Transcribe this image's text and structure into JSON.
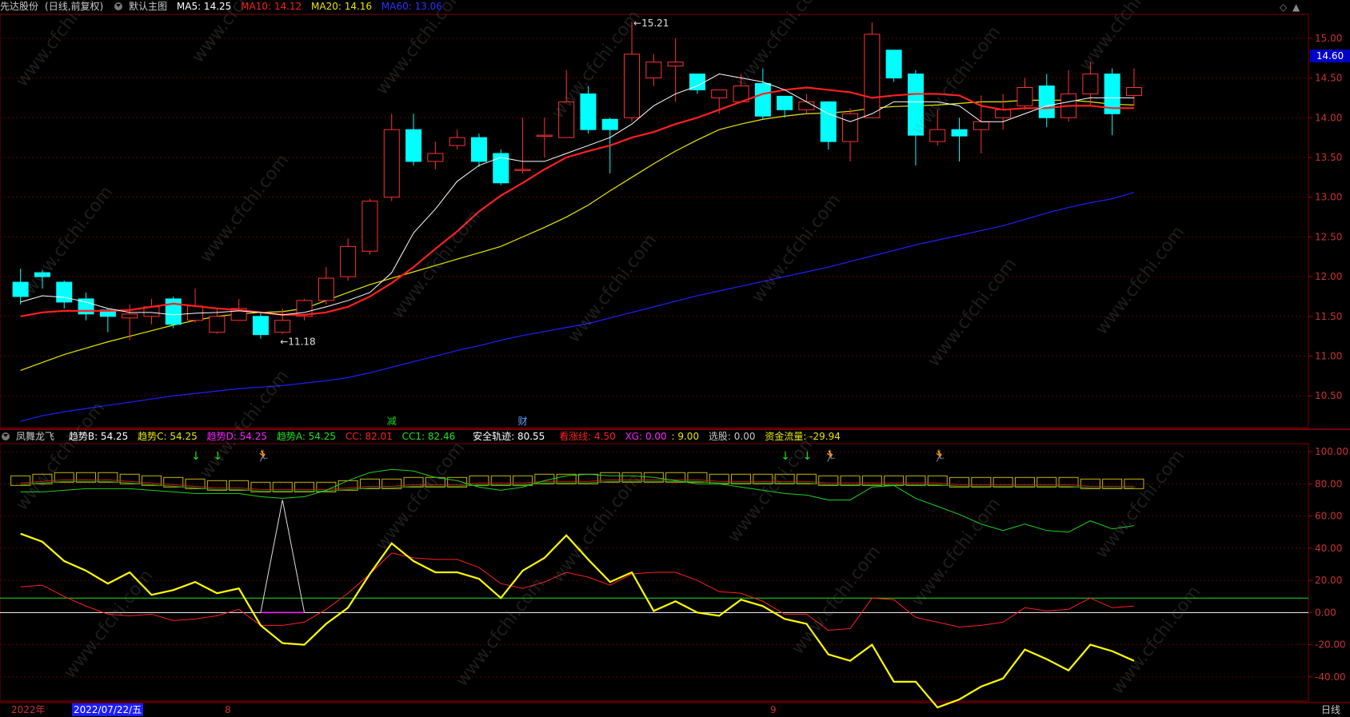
{
  "header_main": {
    "stock": "先达股份",
    "stock_mode": "(日线,前复权)",
    "template": "默认主图",
    "ma5": "MA5: 14.25",
    "ma10": "MA10: 14.12",
    "ma20": "MA20: 14.16",
    "ma60": "MA60: 13.06"
  },
  "header_sub": {
    "indicator": "凤舞龙飞",
    "trend_b": "趋势B: 54.25",
    "trend_c": "趋势C: 54.25",
    "trend_d": "趋势D: 54.25",
    "trend_a": "趋势A: 54.25",
    "cc": "CC: 82.01",
    "cc1": "CC1: 82.46",
    "safe": "安全轨迹: 80.55",
    "sz": "看涨线: 4.50",
    "xg": "XG: 0.00",
    "xg2": ": 9.00",
    "pick": "选股: 0.00",
    "flow": "资金流量: -29.94"
  },
  "colors": {
    "up": "#ff3232",
    "down": "#00ffff",
    "ma5": "#ffffff",
    "ma10": "#ff2020",
    "ma20": "#e8e800",
    "ma60": "#2020ff",
    "grid": "#5a0000",
    "axis_text": "#c83232"
  },
  "price_box": "14.60",
  "price_axis": [
    "15.00",
    "14.50",
    "14.00",
    "13.50",
    "13.00",
    "12.50",
    "12.00",
    "11.50",
    "11.00",
    "10.50"
  ],
  "sub_axis": [
    "100.00",
    "80.00",
    "60.00",
    "40.00",
    "20.00",
    "0.00",
    "-20.00",
    "-40.00"
  ],
  "annotations": {
    "high": "15.21",
    "low": "11.18",
    "mark1": "减",
    "mark2": "财"
  },
  "datebar": {
    "year": "2022年",
    "date": "2022/07/22/五",
    "m8": "8",
    "m9": "9",
    "period": "日线"
  },
  "watermark": "www.cfchi.com",
  "chart_data": {
    "type": "candlestick",
    "ylim": [
      10.1,
      15.3
    ],
    "candles": [
      [
        11.93,
        11.75,
        12.1,
        11.65
      ],
      [
        12.05,
        12.0,
        12.08,
        11.85
      ],
      [
        11.93,
        11.68,
        11.95,
        11.6
      ],
      [
        11.72,
        11.53,
        11.8,
        11.45
      ],
      [
        11.58,
        11.5,
        11.6,
        11.3
      ],
      [
        11.48,
        11.53,
        11.65,
        11.2
      ],
      [
        11.5,
        11.62,
        11.72,
        11.4
      ],
      [
        11.72,
        11.4,
        11.75,
        11.35
      ],
      [
        11.45,
        11.63,
        11.85,
        11.42
      ],
      [
        11.3,
        11.5,
        11.6,
        11.28
      ],
      [
        11.45,
        11.6,
        11.72,
        11.45
      ],
      [
        11.5,
        11.27,
        11.55,
        11.22
      ],
      [
        11.3,
        11.45,
        11.6,
        11.28
      ],
      [
        11.5,
        11.7,
        11.72,
        11.45
      ],
      [
        11.7,
        11.98,
        12.12,
        11.65
      ],
      [
        12.0,
        12.38,
        12.48,
        11.95
      ],
      [
        12.32,
        12.95,
        12.98,
        12.28
      ],
      [
        13.0,
        13.85,
        14.05,
        12.95
      ],
      [
        13.85,
        13.45,
        14.05,
        13.4
      ],
      [
        13.45,
        13.55,
        13.7,
        13.35
      ],
      [
        13.65,
        13.75,
        13.85,
        13.6
      ],
      [
        13.75,
        13.45,
        13.8,
        13.38
      ],
      [
        13.55,
        13.18,
        13.6,
        13.15
      ],
      [
        13.35,
        13.35,
        14.0,
        13.3
      ],
      [
        13.78,
        13.78,
        14.0,
        13.5
      ],
      [
        13.75,
        14.2,
        14.6,
        13.75
      ],
      [
        14.3,
        13.85,
        14.4,
        13.8
      ],
      [
        13.98,
        13.85,
        14.0,
        13.3
      ],
      [
        14.0,
        14.8,
        15.21,
        13.95
      ],
      [
        14.5,
        14.7,
        14.8,
        14.4
      ],
      [
        14.65,
        14.7,
        15.0,
        14.2
      ],
      [
        14.55,
        14.35,
        14.55,
        14.3
      ],
      [
        14.25,
        14.35,
        14.35,
        14.05
      ],
      [
        14.2,
        14.4,
        14.55,
        14.2
      ],
      [
        14.43,
        14.02,
        14.62,
        13.98
      ],
      [
        14.27,
        14.1,
        14.27,
        14.0
      ],
      [
        14.1,
        14.2,
        14.3,
        14.05
      ],
      [
        14.2,
        13.7,
        14.2,
        13.6
      ],
      [
        13.7,
        14.05,
        14.12,
        13.45
      ],
      [
        14.0,
        15.05,
        15.2,
        14.0
      ],
      [
        14.85,
        14.5,
        14.85,
        14.45
      ],
      [
        14.55,
        13.78,
        14.6,
        13.4
      ],
      [
        13.7,
        13.85,
        14.1,
        13.65
      ],
      [
        13.85,
        13.77,
        14.0,
        13.45
      ],
      [
        13.85,
        13.95,
        14.28,
        13.55
      ],
      [
        14.0,
        14.1,
        14.3,
        13.85
      ],
      [
        14.15,
        14.38,
        14.5,
        14.1
      ],
      [
        14.4,
        14.0,
        14.55,
        13.88
      ],
      [
        14.0,
        14.3,
        14.6,
        13.95
      ],
      [
        14.3,
        14.55,
        14.7,
        14.15
      ],
      [
        14.55,
        14.05,
        14.62,
        13.78
      ],
      [
        14.28,
        14.38,
        14.62,
        14.15
      ]
    ],
    "ma5": [
      11.68,
      11.76,
      11.74,
      11.68,
      11.6,
      11.55,
      11.55,
      11.52,
      11.54,
      11.55,
      11.57,
      11.55,
      11.52,
      11.55,
      11.62,
      11.7,
      11.8,
      12.05,
      12.55,
      12.85,
      13.2,
      13.4,
      13.5,
      13.45,
      13.45,
      13.55,
      13.65,
      13.75,
      13.92,
      14.15,
      14.3,
      14.4,
      14.55,
      14.5,
      14.45,
      14.35,
      14.2,
      14.05,
      13.95,
      14.05,
      14.2,
      14.2,
      14.2,
      14.15,
      13.95,
      13.95,
      14.05,
      14.15,
      14.2,
      14.25,
      14.25,
      14.25
    ],
    "ma10": [
      11.5,
      11.55,
      11.57,
      11.57,
      11.57,
      11.58,
      11.62,
      11.66,
      11.63,
      11.6,
      11.58,
      11.55,
      11.52,
      11.52,
      11.55,
      11.62,
      11.75,
      11.92,
      12.12,
      12.35,
      12.57,
      12.82,
      13.02,
      13.18,
      13.35,
      13.5,
      13.58,
      13.65,
      13.75,
      13.82,
      13.92,
      14.0,
      14.1,
      14.2,
      14.3,
      14.35,
      14.38,
      14.35,
      14.32,
      14.25,
      14.28,
      14.3,
      14.3,
      14.28,
      14.15,
      14.1,
      14.12,
      14.12,
      14.15,
      14.15,
      14.12,
      14.12
    ],
    "ma20": [
      10.82,
      10.92,
      11.02,
      11.1,
      11.18,
      11.25,
      11.32,
      11.39,
      11.45,
      11.5,
      11.53,
      11.55,
      11.56,
      11.6,
      11.7,
      11.8,
      11.9,
      11.98,
      12.06,
      12.14,
      12.22,
      12.3,
      12.38,
      12.5,
      12.62,
      12.75,
      12.9,
      13.08,
      13.25,
      13.42,
      13.58,
      13.72,
      13.85,
      13.92,
      13.98,
      14.02,
      14.05,
      14.06,
      14.08,
      14.12,
      14.14,
      14.15,
      14.16,
      14.18,
      14.2,
      14.2,
      14.22,
      14.22,
      14.22,
      14.2,
      14.17,
      14.16
    ],
    "ma60": [
      10.18,
      10.25,
      10.3,
      10.34,
      10.38,
      10.42,
      10.46,
      10.5,
      10.53,
      10.56,
      10.59,
      10.61,
      10.63,
      10.66,
      10.69,
      10.73,
      10.79,
      10.86,
      10.93,
      11.0,
      11.07,
      11.13,
      11.2,
      11.26,
      11.31,
      11.36,
      11.41,
      11.48,
      11.55,
      11.62,
      11.69,
      11.76,
      11.82,
      11.88,
      11.94,
      12.0,
      12.06,
      12.12,
      12.19,
      12.26,
      12.33,
      12.4,
      12.46,
      12.52,
      12.58,
      12.64,
      12.72,
      12.8,
      12.87,
      12.93,
      12.98,
      13.06
    ],
    "sub": {
      "ylim": [
        -55,
        105
      ],
      "yellow": [
        49,
        44,
        32,
        26,
        18,
        25,
        11,
        14,
        19,
        12,
        15,
        -8,
        -19,
        -20,
        -7,
        3,
        24,
        43,
        32,
        25,
        25,
        21,
        9,
        26,
        34,
        48,
        33,
        19,
        25,
        1,
        7,
        0,
        -2,
        8,
        4,
        -4,
        -7,
        -26,
        -30,
        -20,
        -43,
        -43,
        -59,
        -54,
        -46,
        -41,
        -23,
        -29,
        -36,
        -20,
        -24,
        -30
      ],
      "red": [
        16,
        17,
        10,
        4,
        -1,
        -2,
        -1,
        -5,
        -4,
        -2,
        2,
        -8,
        -8,
        -6,
        2,
        12,
        24,
        37,
        34,
        33,
        33,
        28,
        18,
        15,
        19,
        25,
        22,
        17,
        24,
        25,
        25,
        20,
        13,
        12,
        7,
        -1,
        -1,
        -11,
        -10,
        9,
        8,
        -3,
        -6,
        -9,
        -8,
        -6,
        3,
        1,
        2,
        9,
        3,
        4
      ],
      "green": [
        75,
        75,
        76,
        77,
        77,
        77,
        76,
        75,
        74,
        74,
        74,
        72,
        71,
        72,
        76,
        82,
        87,
        89,
        88,
        84,
        82,
        78,
        76,
        78,
        82,
        85,
        86,
        85,
        85,
        84,
        82,
        80,
        80,
        78,
        76,
        74,
        73,
        70,
        70,
        78,
        79,
        71,
        66,
        61,
        55,
        51,
        55,
        51,
        50,
        57,
        52,
        54
      ],
      "white_spike": [
        [
          11,
          0
        ],
        [
          12,
          70
        ],
        [
          13,
          0
        ]
      ],
      "band": [
        82,
        83,
        84,
        84,
        84,
        83,
        82,
        81,
        80,
        79,
        79,
        78,
        78,
        78,
        78,
        79,
        80,
        80,
        81,
        81,
        81,
        82,
        82,
        82,
        83,
        83,
        83,
        84,
        84,
        84,
        84,
        84,
        83,
        83,
        83,
        83,
        83,
        82,
        82,
        82,
        82,
        82,
        82,
        81,
        81,
        81,
        81,
        81,
        81,
        80,
        80,
        80
      ],
      "green_line": 9,
      "white_line": 0
    }
  }
}
